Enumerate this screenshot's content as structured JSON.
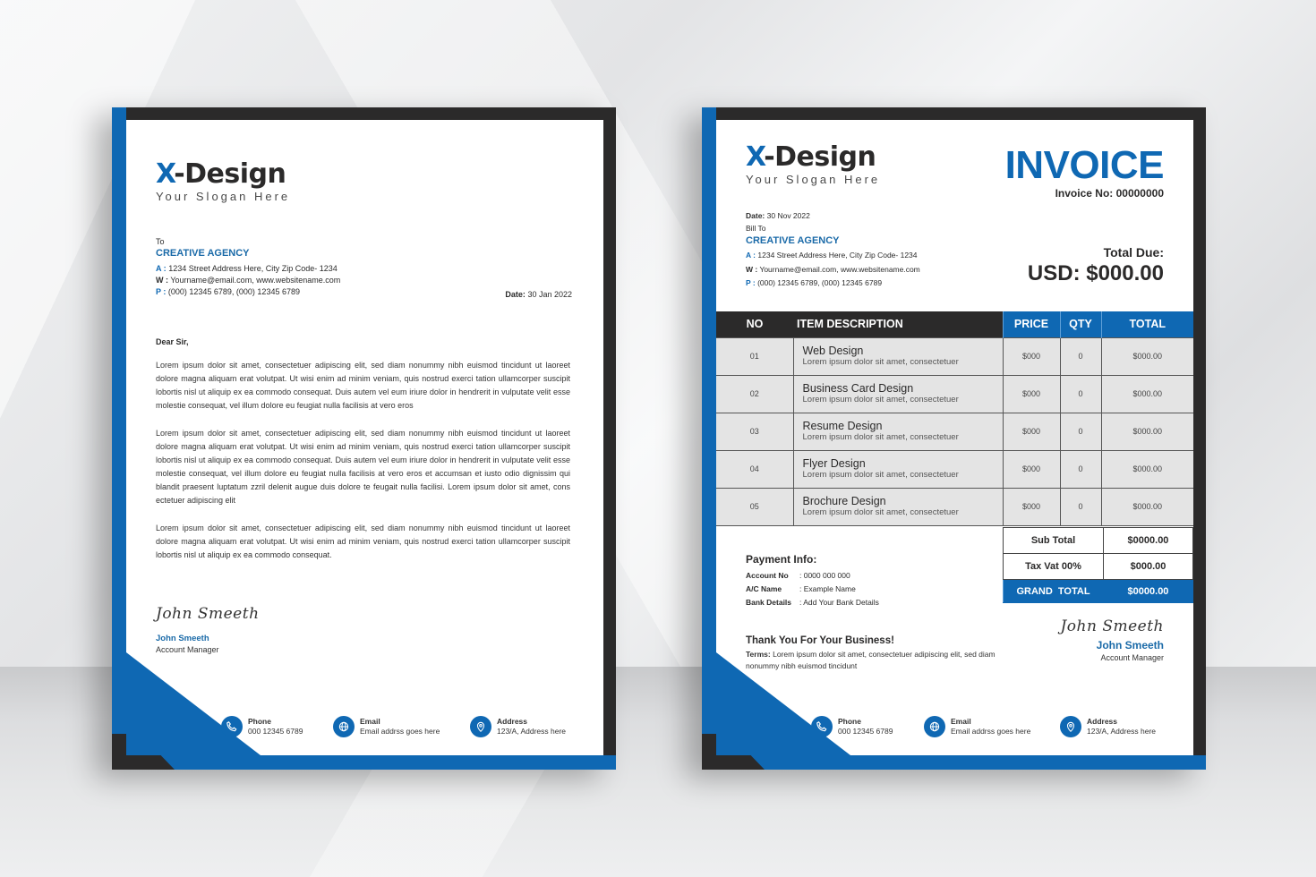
{
  "brand": {
    "name_prefix": "X",
    "name_rest": "-Design",
    "slogan": "Your Slogan Here"
  },
  "colors": {
    "accent": "#0f68b3",
    "dark": "#2b2a2a",
    "table_row_bg": "#e4e4e4"
  },
  "contacts": [
    {
      "icon": "phone-icon",
      "label": "Phone",
      "value": "000 12345 6789"
    },
    {
      "icon": "globe-icon",
      "label": "Email",
      "value": "Email addrss goes here"
    },
    {
      "icon": "location-pin-icon",
      "label": "Address",
      "value": "123/A, Address here"
    }
  ],
  "letterhead": {
    "to_label": "To",
    "recipient": "CREATIVE AGENCY",
    "address_key": "A :",
    "address": "1234 Street Address Here, City Zip Code- 1234",
    "web_key": "W :",
    "web": "Yourname@email.com, www.websitename.com",
    "phone_key": "P :",
    "phone": "(000) 12345 6789, (000) 12345 6789",
    "date_label": "Date:",
    "date": "30 Jan 2022",
    "greeting": "Dear Sir,",
    "paragraphs": [
      "Lorem ipsum dolor sit amet, consectetuer adipiscing elit, sed diam nonummy nibh euismod tincidunt ut laoreet dolore magna aliquam erat volutpat. Ut wisi enim ad minim veniam, quis nostrud exerci tation ullamcorper suscipit lobortis nisl ut aliquip ex ea commodo consequat. Duis autem vel eum iriure dolor in hendrerit in vulputate velit esse molestie consequat, vel illum dolore eu feugiat nulla facilisis at vero eros",
      "Lorem ipsum dolor sit amet, consectetuer adipiscing elit, sed diam nonummy nibh euismod tincidunt ut laoreet dolore magna aliquam erat volutpat. Ut wisi enim ad minim veniam, quis nostrud exerci tation ullamcorper suscipit lobortis nisl ut aliquip ex ea commodo consequat. Duis autem vel eum iriure dolor in hendrerit in vulputate velit esse molestie consequat, vel illum dolore eu feugiat nulla facilisis at vero eros et accumsan et iusto odio dignissim qui blandit praesent luptatum zzril delenit augue duis dolore te feugait nulla facilisi. Lorem ipsum dolor sit amet, cons ectetuer adipiscing elit",
      "Lorem ipsum dolor sit amet, consectetuer adipiscing elit, sed diam nonummy nibh euismod tincidunt ut laoreet dolore magna aliquam erat volutpat. Ut wisi enim ad minim veniam, quis nostrud exerci tation ullamcorper suscipit lobortis nisl ut aliquip ex ea commodo consequat."
    ],
    "signature_script": "John Smeeth",
    "signer_name": "John Smeeth",
    "signer_role": "Account Manager"
  },
  "invoice": {
    "title": "INVOICE",
    "number_label": "Invoice No: 00000000",
    "date_label": "Date:",
    "date": "30 Nov 2022",
    "bill_to_label": "Bill To",
    "recipient": "CREATIVE AGENCY",
    "address_key": "A :",
    "address": "1234 Street Address Here, City Zip Code- 1234",
    "web_key": "W :",
    "web": "Yourname@email.com, www.websitename.com",
    "phone_key": "P :",
    "phone": "(000) 12345 6789, (000) 12345 6789",
    "total_due_label": "Total Due:",
    "total_due_amount": "USD: $000.00",
    "table": {
      "headers": {
        "no": "NO",
        "desc": "ITEM DESCRIPTION",
        "price": "PRICE",
        "qty": "QTY",
        "total": "TOTAL"
      },
      "rows": [
        {
          "no": "01",
          "title": "Web Design",
          "sub": "Lorem ipsum dolor sit amet, consectetuer",
          "price": "$000",
          "qty": "0",
          "total": "$000.00"
        },
        {
          "no": "02",
          "title": "Business Card Design",
          "sub": "Lorem ipsum dolor sit amet, consectetuer",
          "price": "$000",
          "qty": "0",
          "total": "$000.00"
        },
        {
          "no": "03",
          "title": "Resume Design",
          "sub": "Lorem ipsum dolor sit amet, consectetuer",
          "price": "$000",
          "qty": "0",
          "total": "$000.00"
        },
        {
          "no": "04",
          "title": "Flyer Design",
          "sub": "Lorem ipsum dolor sit amet, consectetuer",
          "price": "$000",
          "qty": "0",
          "total": "$000.00"
        },
        {
          "no": "05",
          "title": "Brochure Design",
          "sub": "Lorem ipsum dolor sit amet, consectetuer",
          "price": "$000",
          "qty": "0",
          "total": "$000.00"
        }
      ]
    },
    "totals": {
      "subtotal_label": "Sub Total",
      "subtotal": "$0000.00",
      "tax_label": "Tax Vat 00%",
      "tax": "$000.00",
      "grand_label": "GRAND  TOTAL",
      "grand": "$0000.00"
    },
    "payment": {
      "heading": "Payment Info:",
      "rows": [
        {
          "key": "Account No",
          "value": ": 0000 000 000"
        },
        {
          "key": "A/C Name",
          "value": ": Example Name"
        },
        {
          "key": "Bank Details",
          "value": ": Add Your Bank Details"
        }
      ]
    },
    "thanks_heading": "Thank You For Your Business!",
    "terms_label": "Terms:",
    "terms_text": "Lorem ipsum dolor sit amet, consectetuer adipiscing elit, sed diam nonummy nibh euismod tincidunt",
    "signature_script": "John Smeeth",
    "signer_name": "John Smeeth",
    "signer_role": "Account Manager"
  }
}
